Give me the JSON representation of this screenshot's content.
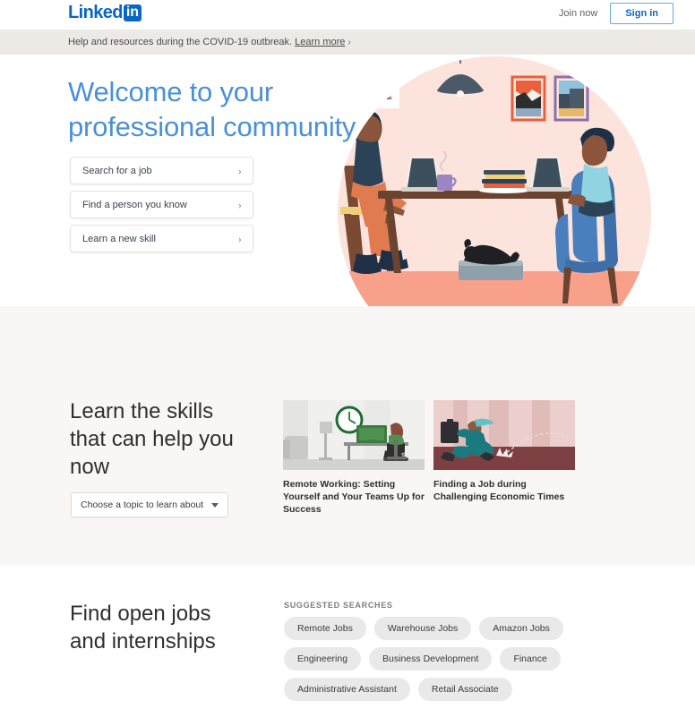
{
  "header": {
    "logo_text": "Linked",
    "logo_box": "in",
    "join_now": "Join now",
    "sign_in": "Sign in"
  },
  "banner": {
    "text": "Help and resources during the COVID-19 outbreak.",
    "link": "Learn more",
    "chevron": "›"
  },
  "hero": {
    "title_line1": "Welcome to your",
    "title_line2": "professional community",
    "title_color": "#4a90d9",
    "cta": [
      {
        "label": "Search for a job",
        "chevron": "›"
      },
      {
        "label": "Find a person you know",
        "chevron": "›"
      },
      {
        "label": "Learn a new skill",
        "chevron": "›"
      }
    ]
  },
  "learn": {
    "title_line1": "Learn the skills",
    "title_line2": "that can help you",
    "title_line3": "now",
    "select_value": "Choose a topic to learn about",
    "courses": [
      {
        "title": "Remote Working: Setting Yourself and Your Teams Up for Success"
      },
      {
        "title": "Finding a Job during Challenging Economic Times"
      }
    ]
  },
  "jobs": {
    "title_line1": "Find open jobs",
    "title_line2": "and internships",
    "suggested_label": "SUGGESTED SEARCHES",
    "chips": [
      "Remote Jobs",
      "Warehouse Jobs",
      "Amazon Jobs",
      "Engineering",
      "Business Development",
      "Finance",
      "Administrative Assistant",
      "Retail Associate"
    ]
  },
  "colors": {
    "brand_blue": "#0a66c2",
    "banner_bg": "#edeae5",
    "section_bg": "#f9f7f5",
    "illustration_circle": "#fce3dc",
    "illustration_floor": "#f9a08b",
    "chip_bg": "#e9e9e9"
  }
}
